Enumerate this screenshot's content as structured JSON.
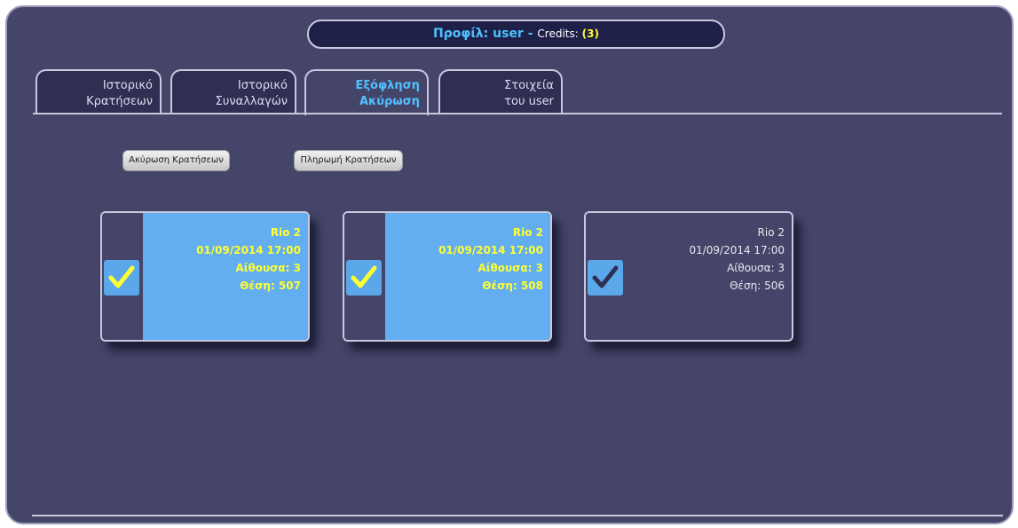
{
  "header": {
    "profile_label": "Προφίλ: user",
    "separator": " - ",
    "credits_label": "Credits: ",
    "credits_value": "(3)"
  },
  "tabs": [
    {
      "line1": "Ιστορικό",
      "line2": "Κρατήσεων",
      "active": false
    },
    {
      "line1": "Ιστορικό",
      "line2": "Συναλλαγών",
      "active": false
    },
    {
      "line1": "Εξόφληση",
      "line2": "Ακύρωση",
      "active": true
    },
    {
      "line1": "Στοιχεία",
      "line2": "του user",
      "active": false
    }
  ],
  "actions": {
    "cancel_label": "Ακύρωση Κρατήσεων",
    "pay_label": "Πληρωμή Κρατήσεων"
  },
  "bookings": [
    {
      "cinema": "Rio 2",
      "datetime": "01/09/2014 17:00",
      "hall": "Αίθουσα: 3",
      "seat": "Θέση: 507",
      "selected": true
    },
    {
      "cinema": "Rio 2",
      "datetime": "01/09/2014 17:00",
      "hall": "Αίθουσα: 3",
      "seat": "Θέση: 508",
      "selected": true
    },
    {
      "cinema": "Rio 2",
      "datetime": "01/09/2014 17:00",
      "hall": "Αίθουσα: 3",
      "seat": "Θέση: 506",
      "selected": false
    }
  ],
  "colors": {
    "background": "#45456a",
    "selected_card": "#62aef0",
    "selected_text": "#ffff33",
    "accent": "#4fc0ff",
    "check_selected": "#ffff33",
    "check_unselected": "#2e2f52"
  }
}
